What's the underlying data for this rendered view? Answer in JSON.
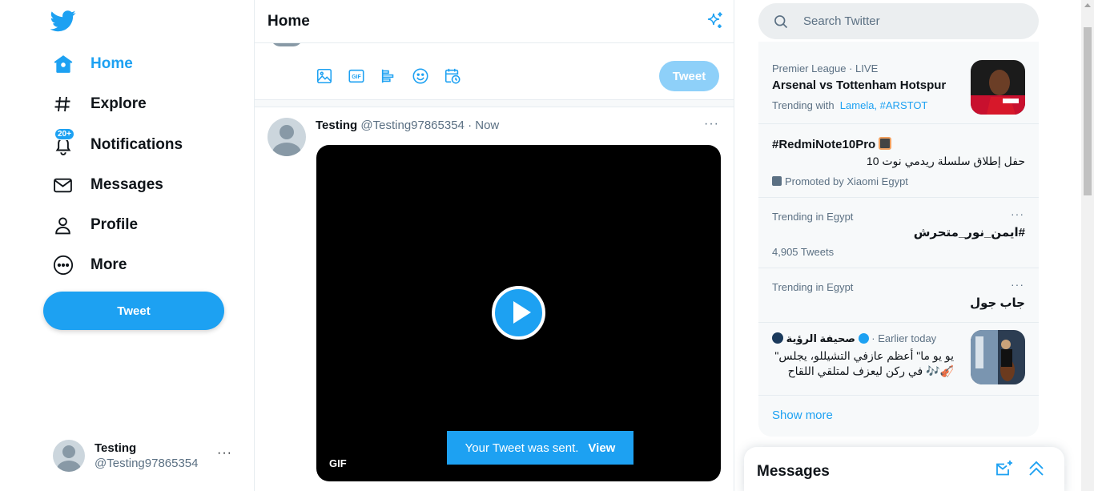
{
  "colors": {
    "accent": "#1da1f2",
    "text": "#0f1419",
    "muted": "#5b7083"
  },
  "nav": {
    "items": [
      {
        "label": "Home",
        "icon": "home-icon",
        "active": true
      },
      {
        "label": "Explore",
        "icon": "hashtag-icon"
      },
      {
        "label": "Notifications",
        "icon": "bell-icon",
        "badge": "20+"
      },
      {
        "label": "Messages",
        "icon": "envelope-icon"
      },
      {
        "label": "Profile",
        "icon": "person-icon"
      },
      {
        "label": "More",
        "icon": "more-circle-icon"
      }
    ],
    "tweet_button": "Tweet"
  },
  "account": {
    "name": "Testing",
    "handle": "@Testing97865354",
    "more": "···"
  },
  "header": {
    "title": "Home"
  },
  "compose": {
    "tweet_button": "Tweet",
    "tools": [
      "image-icon",
      "gif-icon",
      "poll-icon",
      "emoji-icon",
      "schedule-icon"
    ]
  },
  "tweet": {
    "name": "Testing",
    "handle": "@Testing97865354",
    "time": "· Now",
    "more": "···",
    "media_tag": "GIF"
  },
  "toast": {
    "text": "Your Tweet was sent.",
    "action": "View"
  },
  "search": {
    "placeholder": "Search Twitter"
  },
  "trends": [
    {
      "meta": "Premier League · LIVE",
      "title": "Arsenal vs Tottenham Hotspur",
      "with_label": "Trending with",
      "with_links": "Lamela, #ARSTOT"
    },
    {
      "title": "#RedmiNote10Pro",
      "subtitle": "حفل إطلاق سلسلة ريدمي نوت 10",
      "promoted": "Promoted by Xiaomi Egypt"
    },
    {
      "meta": "Trending in Egypt",
      "title": "#ايمن_نور_متحرش",
      "count": "4,905 Tweets",
      "more": "···"
    },
    {
      "meta": "Trending in Egypt",
      "title": "جاب جول",
      "more": "···"
    },
    {
      "source": "صحيفة الرؤية",
      "time": "· Earlier today",
      "text_line1": "يو يو ما\" أعظم عازفي التشيللو، يجلس\"",
      "text_line2": "🎻🎶 في ركن ليعزف لمتلقي اللقاح"
    }
  ],
  "show_more": "Show more",
  "messages": {
    "title": "Messages"
  }
}
